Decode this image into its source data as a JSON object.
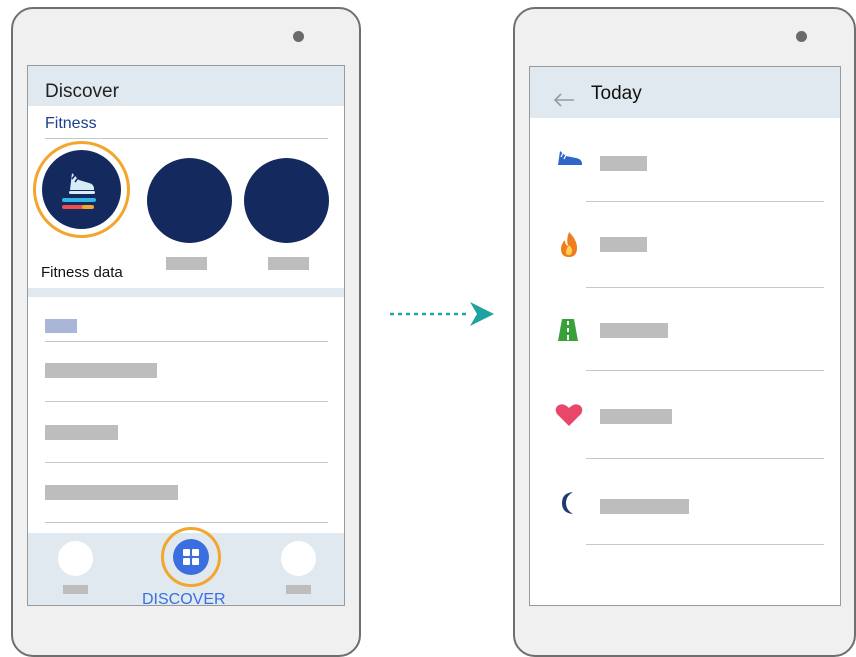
{
  "left_screen": {
    "header_title": "Discover",
    "section_title": "Fitness",
    "featured_card_label": "Fitness data",
    "featured_icon": "running-shoe-icon",
    "bottom_nav_active_label": "DISCOVER",
    "bottom_nav_active_icon": "grid-icon"
  },
  "right_screen": {
    "header_title": "Today",
    "back_icon": "arrow-left-icon",
    "rows": [
      {
        "icon": "shoe-icon"
      },
      {
        "icon": "flame-icon"
      },
      {
        "icon": "road-icon"
      },
      {
        "icon": "heart-icon"
      },
      {
        "icon": "moon-icon"
      }
    ]
  },
  "transition_arrow_icon": "dotted-arrow-right-icon",
  "colors": {
    "header_bg": "#dfe9ef",
    "circle_navy": "#14295e",
    "highlight_orange": "#f2a62b",
    "accent_blue": "#3b6fe0",
    "arrow_teal": "#1fa3a0",
    "placeholder_gray": "#bdbdbd"
  }
}
